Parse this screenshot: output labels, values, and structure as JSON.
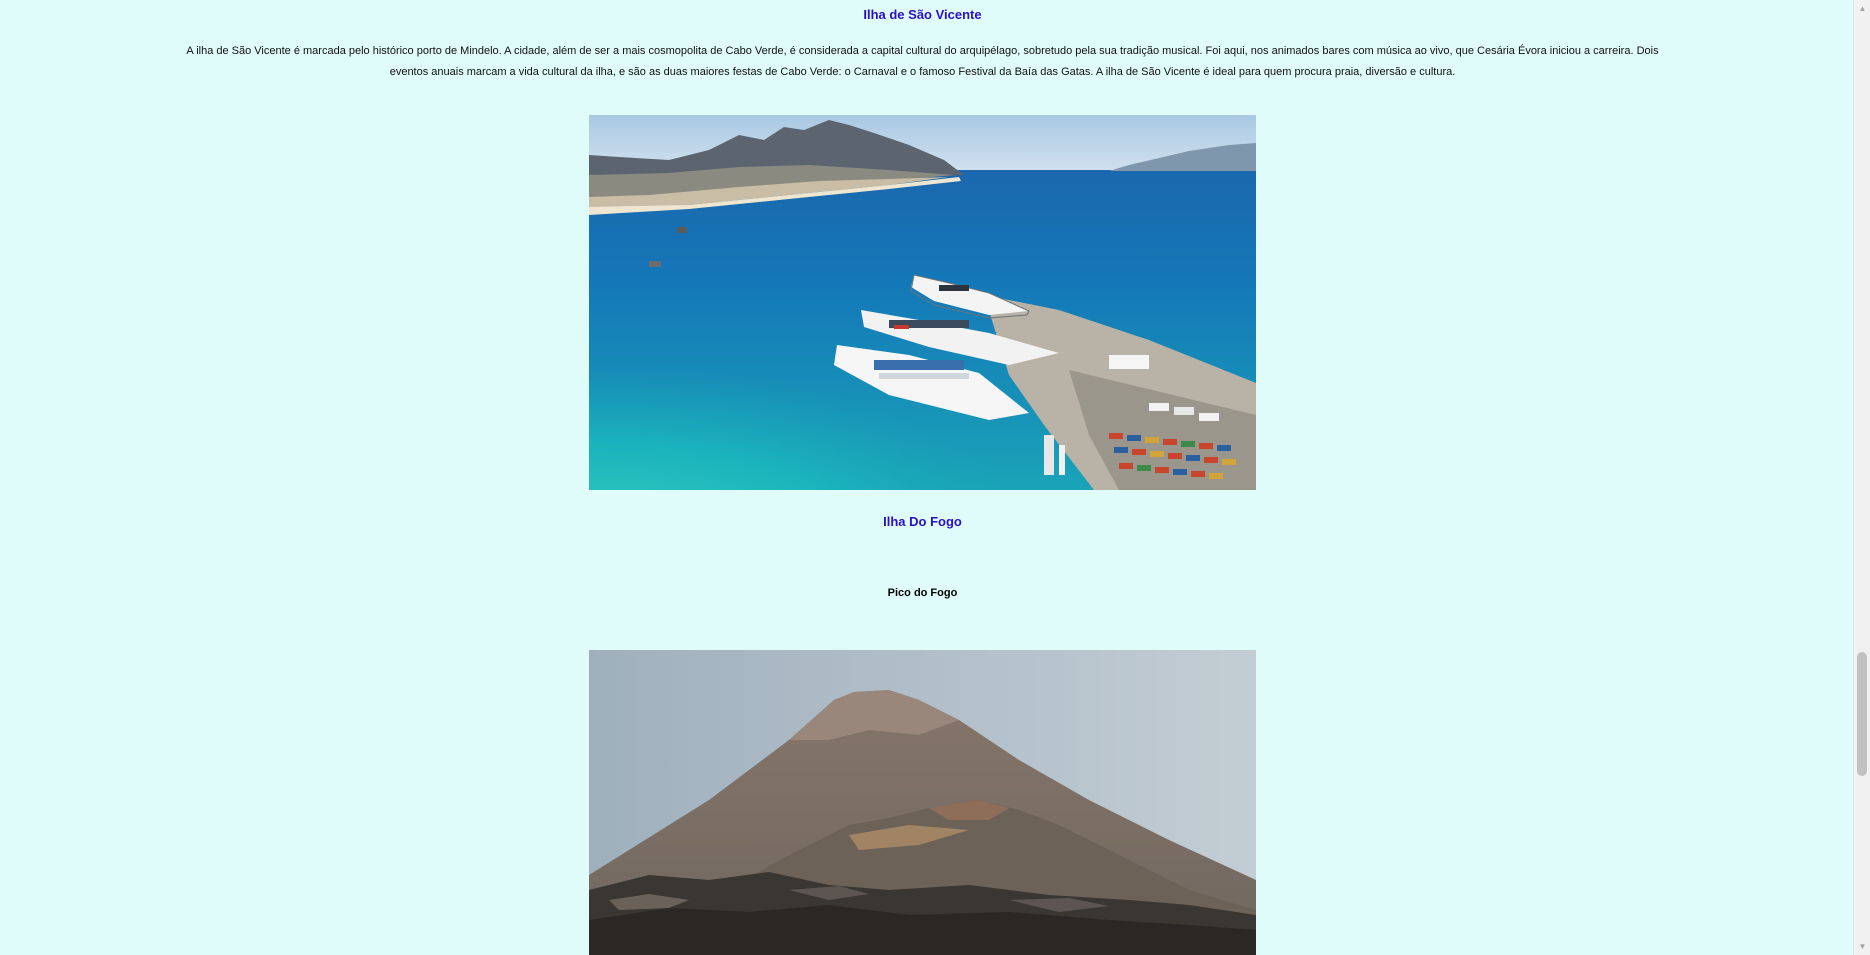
{
  "sao_vicente": {
    "title": "Ilha de São Vicente",
    "description": "A ilha de São Vicente é marcada pelo histórico porto de Mindelo. A cidade, além de ser a mais cosmopolita de Cabo Verde, é considerada a capital cultural do arquipélago, sobretudo pela sua tradição musical. Foi aqui, nos animados bares com música ao vivo, que Cesária Évora iniciou a carreira. Dois eventos anuais marcam a vida cultural da ilha, e são as duas maiores festas de Cabo Verde: o Carnaval e o famoso Festival da Baía das Gatas. A ilha de São Vicente é ideal para quem procura praia, diversão e cultura."
  },
  "fogo": {
    "title": "Ilha Do Fogo",
    "subtitle": "Pico do Fogo"
  },
  "icons": {
    "scroll_up": "▲",
    "scroll_down": "▼"
  },
  "colors": {
    "background": "#e0fcfa",
    "heading": "#2a10c8"
  },
  "scroll": {
    "position": 0.72
  }
}
